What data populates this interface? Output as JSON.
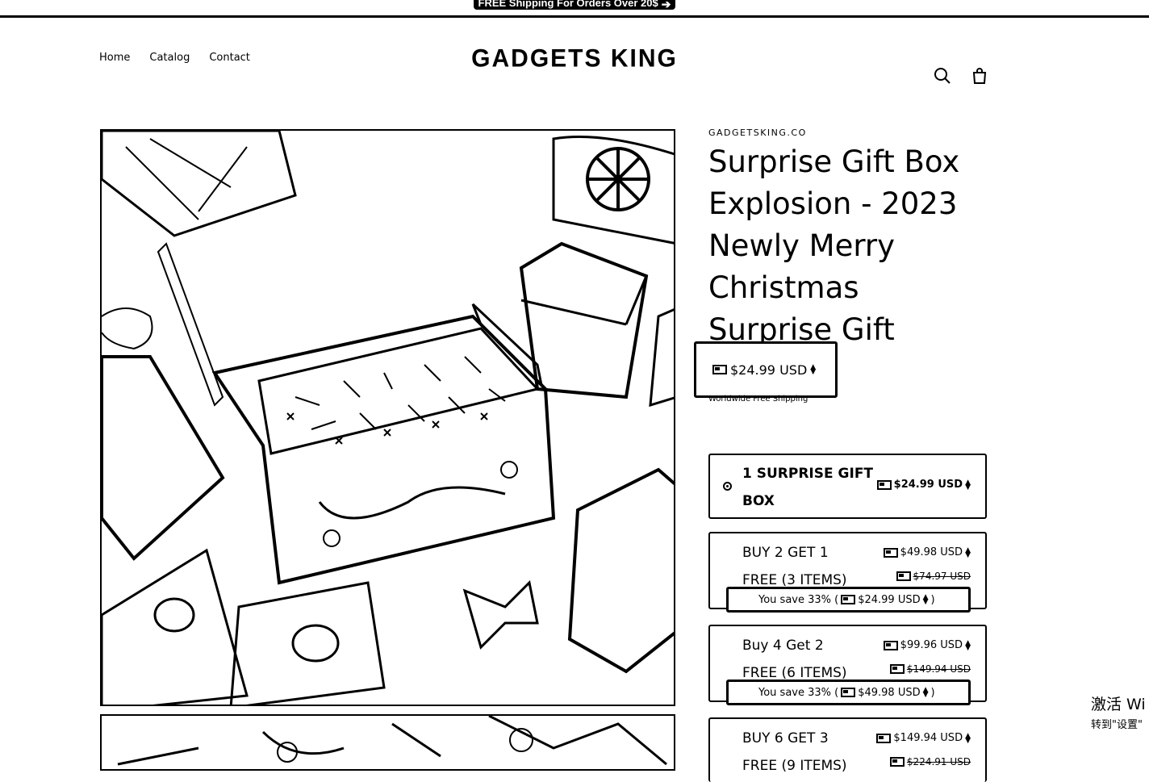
{
  "announcement": {
    "text": "FREE Shipping For Orders Over 20$",
    "arrow_icon": "arrow-right-icon"
  },
  "header": {
    "nav": [
      "Home",
      "Catalog",
      "Contact"
    ],
    "logo": "GADGETS KING",
    "icons": [
      "search-icon",
      "cart-icon"
    ]
  },
  "product": {
    "vendor": "GADGETSKING.CO",
    "title": "Surprise Gift Box Explosion - 2023 Newly Merry Christmas Surprise Gift",
    "price": "$24.99 USD",
    "shipping": "Worldwide Free Shipping"
  },
  "offers": [
    {
      "title": "1 SURPRISE GIFT BOX",
      "price": "$24.99 USD",
      "selected": true
    },
    {
      "title": "BUY 2 GET 1 FREE (3 ITEMS)",
      "price": "$49.98 USD",
      "compare": "$74.97 USD",
      "save_prefix": "You save 33% (",
      "save_amount": "$24.99 USD",
      "save_suffix": ")"
    },
    {
      "title": "Buy 4 Get 2 FREE (6 ITEMS)",
      "price": "$99.96 USD",
      "compare": "$149.94 USD",
      "save_prefix": "You save 33% (",
      "save_amount": "$49.98 USD",
      "save_suffix": ")"
    },
    {
      "title": "BUY 6 GET 3 FREE (9 ITEMS)",
      "price": "$149.94 USD",
      "compare": "$224.91 USD"
    }
  ],
  "watermark": {
    "line1": "激活 Wi",
    "line2": "转到\"设置\""
  }
}
